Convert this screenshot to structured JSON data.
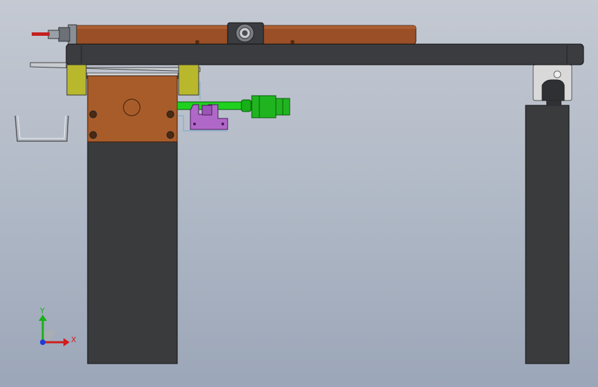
{
  "triad": {
    "x_label": "X",
    "y_label": "Y",
    "x_color": "#d11c1c",
    "y_color": "#19b019",
    "z_color": "#1f3cd6"
  },
  "colors": {
    "background_top": "#c4c9d2",
    "background_bottom": "#9ba6b8",
    "cylinder": "#9b4f26",
    "beam": "#3b3c3f",
    "pillar": "#3a3b3d",
    "bracket": "#b9b82d",
    "motor_block": "#a85c2a",
    "shaft": "#1fd11f",
    "coupler": "#20b520",
    "clamp": "#b068c8",
    "rail_block": "#d9d9d9"
  }
}
